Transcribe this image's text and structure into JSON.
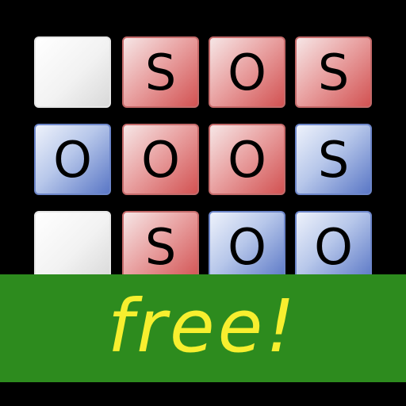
{
  "game": {
    "board": {
      "rows": [
        [
          {
            "letter": "",
            "state": "empty"
          },
          {
            "letter": "S",
            "state": "red"
          },
          {
            "letter": "O",
            "state": "red"
          },
          {
            "letter": "S",
            "state": "red"
          }
        ],
        [
          {
            "letter": "O",
            "state": "blue"
          },
          {
            "letter": "O",
            "state": "red"
          },
          {
            "letter": "O",
            "state": "red"
          },
          {
            "letter": "S",
            "state": "blue"
          }
        ],
        [
          {
            "letter": "",
            "state": "empty"
          },
          {
            "letter": "S",
            "state": "red"
          },
          {
            "letter": "O",
            "state": "blue"
          },
          {
            "letter": "O",
            "state": "blue"
          }
        ]
      ]
    },
    "banner": {
      "label": "free!"
    },
    "colors": {
      "background": "#000000",
      "player_red": "#d25252",
      "player_blue": "#5a77c6",
      "empty": "#f2f2f2",
      "banner_bg": "#2d8b1e",
      "banner_text": "#f7ef2f"
    }
  }
}
